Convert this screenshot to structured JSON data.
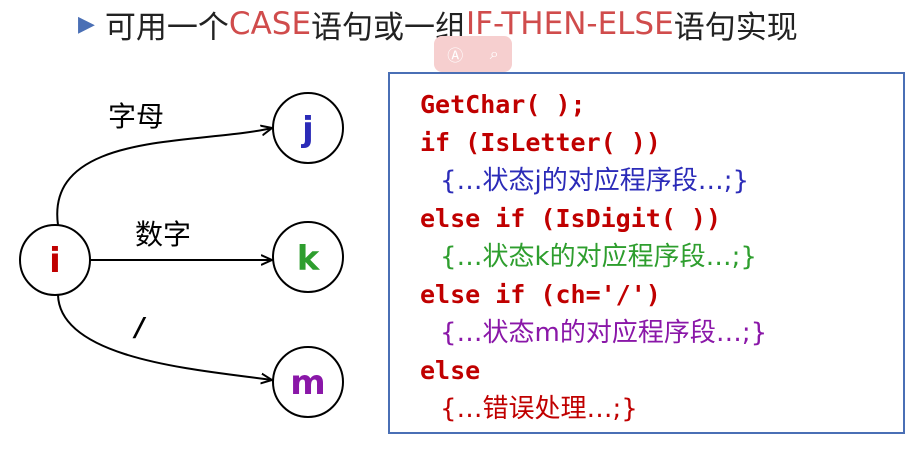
{
  "title": {
    "prefix": "可用一个",
    "case": "CASE",
    "mid": "语句或一组",
    "ifthen": "IF-THEN-ELSE",
    "suffix": "语句实现"
  },
  "diagram": {
    "nodes": {
      "i": "i",
      "j": "j",
      "k": "k",
      "m": "m"
    },
    "edges": {
      "letter": "字母",
      "digit": "数字",
      "slash": "/"
    },
    "colors": {
      "i": "#c00000",
      "j": "#2b2bb8",
      "k": "#2e9e2e",
      "m": "#8a17a8"
    }
  },
  "code": {
    "line1": "GetChar( );",
    "line2": "if (IsLetter( ))",
    "line3": "{…状态j的对应程序段…;}",
    "line4": "else if (IsDigit( ))",
    "line5": "{…状态k的对应程序段…;}",
    "line6": "else if (ch='/')",
    "line7": "{…状态m的对应程序段…;}",
    "line8": "else",
    "line9": "{…错误处理…;}",
    "colors": {
      "keyword": "#c00000",
      "j": "#2b2bb8",
      "k": "#2e9e2e",
      "m": "#8a17a8",
      "err": "#c00000"
    }
  }
}
